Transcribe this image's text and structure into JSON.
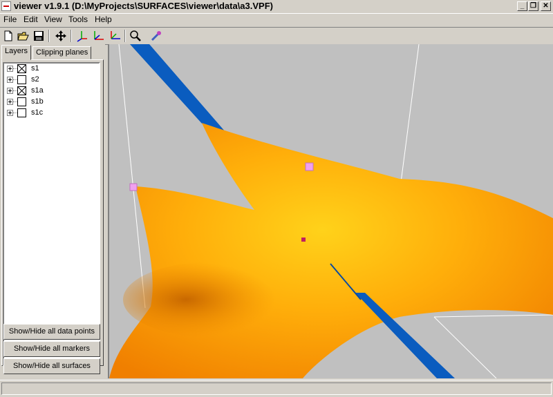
{
  "window": {
    "title": "viewer v1.9.1 (D:\\MyProjects\\SURFACES\\viewer\\data\\a3.VPF)",
    "controls": {
      "minimize": "_",
      "restore": "❐",
      "close": "✕"
    }
  },
  "menu": [
    {
      "label": "File"
    },
    {
      "label": "Edit"
    },
    {
      "label": "View"
    },
    {
      "label": "Tools"
    },
    {
      "label": "Help"
    }
  ],
  "toolbar": {
    "icons": [
      "new-file-icon",
      "open-folder-icon",
      "save-icon",
      "pan-move-icon",
      "axes-xy-icon",
      "axes-xz-icon",
      "axes-yz-icon",
      "zoom-icon",
      "pick-icon"
    ]
  },
  "tabs": [
    {
      "label": "Layers",
      "active": true
    },
    {
      "label": "Clipping planes",
      "active": false
    }
  ],
  "layers": [
    {
      "label": "s1",
      "checked": true
    },
    {
      "label": "s2",
      "checked": false
    },
    {
      "label": "s1a",
      "checked": true
    },
    {
      "label": "s1b",
      "checked": false
    },
    {
      "label": "s1c",
      "checked": false
    }
  ],
  "buttons": {
    "show_hide_data_points": "Show/Hide all data points",
    "show_hide_markers": "Show/Hide all markers",
    "show_hide_surfaces": "Show/Hide all surfaces"
  },
  "colors": {
    "viewport_bg": "#c0c0c0",
    "surface": "#ffa500",
    "plane": "#0a5cbf",
    "marker": "#f0a0f0"
  },
  "status": {
    "text": ""
  }
}
